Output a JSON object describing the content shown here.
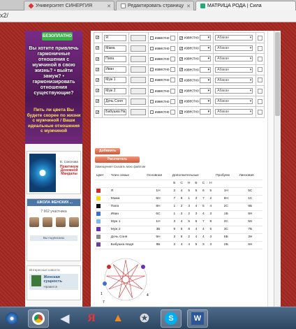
{
  "browser": {
    "tabs": [
      {
        "label": "Университет СИНЕРГИЯ",
        "color": "#d33"
      },
      {
        "label": "Редактировать страницу",
        "color": "#888"
      },
      {
        "label": "МАТРИЦА РОДА | Сила",
        "color": "#2a7"
      }
    ],
    "address": "x2/"
  },
  "left_ad": {
    "free_label": "БЕЗОПЛАТНО",
    "text1": "Вы хотите привлечь гармоничные отношения с мужчиной в свою жизнь? • выйти замуж? • гармонизировать отношения существующие?",
    "text2": "Пить ли цвета Вы будете скорее по жизни с мужчиной / Ваши идеальные отношения с мужчиной"
  },
  "book": {
    "author": "Е. Соколова",
    "title": "Практикум Денежной Мандалы"
  },
  "vk_widget": {
    "header": "ШКОЛА ЖЕНСКИХ ...",
    "members": "7 962 участника",
    "subscribe": "Вы подписаны"
  },
  "vk_widget2": {
    "header": "Интересные новости",
    "group_name": "Женская сущность",
    "action": "Нравится"
  },
  "form": {
    "known_label": "известно",
    "placeholder_select": "Абакан",
    "rows": [
      {
        "name": "Я"
      },
      {
        "name": "Мама"
      },
      {
        "name": "Папа"
      },
      {
        "name": "Иван"
      },
      {
        "name": "Муж 1"
      },
      {
        "name": "Муж 2"
      },
      {
        "name": "Дочь Соня"
      },
      {
        "name": "Бабушка На"
      }
    ],
    "add_button": "Добавить",
    "calc_button": "Рассчитать",
    "hint": "Замещение! Сказать мою файлом"
  },
  "results": {
    "headers": [
      "Цвет",
      "Член семьи",
      "Основная",
      "Дополнительные",
      "",
      "",
      "",
      "",
      "Пробуем",
      "Линзовая"
    ],
    "subheaders": [
      "",
      "",
      "",
      "Б",
      "С",
      "Н",
      "Б",
      "С",
      "Н",
      "",
      ""
    ],
    "rows": [
      {
        "color": "#d62728",
        "name": "Я",
        "cells": [
          "1Н",
          "2",
          "4",
          "5",
          "5",
          "6",
          "5",
          "1Н",
          "5С"
        ]
      },
      {
        "color": "#ffd700",
        "name": "Мама",
        "cells": [
          "6Н",
          "7",
          "8",
          "1",
          "3",
          "7",
          "2",
          "6Н",
          "1С"
        ]
      },
      {
        "color": "#111111",
        "name": "Папа",
        "cells": [
          "8Н",
          "1",
          "2",
          "3",
          "4",
          "5",
          "4",
          "2С",
          "6Б"
        ]
      },
      {
        "color": "#3b6fd6",
        "name": "Иван",
        "cells": [
          "6С",
          "1",
          "2",
          "2",
          "3",
          "4",
          "3",
          "1Б",
          "8Н"
        ]
      },
      {
        "color": "#7fb7e6",
        "name": "Муж 1",
        "cells": [
          "1Н",
          "3",
          "4",
          "5",
          "6",
          "7",
          "8",
          "2С",
          "5Н"
        ]
      },
      {
        "color": "#6a2dbd",
        "name": "Муж 2",
        "cells": [
          "3Б",
          "9",
          "5",
          "8",
          "4",
          "4",
          "5",
          "3С",
          "7Б"
        ]
      },
      {
        "color": "#888888",
        "name": "Дочь Соня",
        "cells": [
          "9Н",
          "3",
          "8",
          "2",
          "4",
          "4",
          "3",
          "6Б",
          "3Н"
        ]
      },
      {
        "color": "#6b3fa0",
        "name": "Бабушка Надя",
        "cells": [
          "8Б",
          "2",
          "4",
          "4",
          "5",
          "3",
          "3",
          "2Б",
          "6Н"
        ]
      }
    ]
  },
  "star": {
    "labels": [
      "1",
      "7",
      "4"
    ]
  },
  "taskbar": {
    "items": [
      "chrome",
      "media",
      "yandex",
      "vlc",
      "app",
      "skype",
      "word"
    ]
  }
}
